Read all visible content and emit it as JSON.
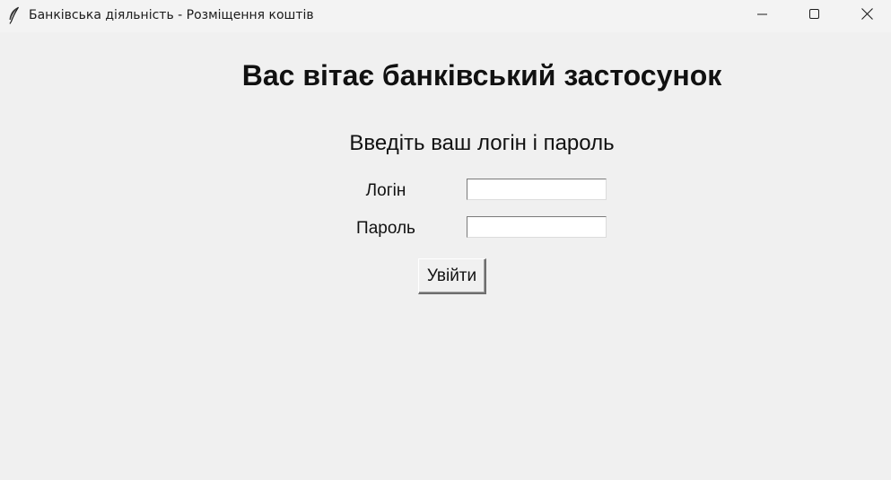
{
  "window": {
    "title": "Банківська діяльність - Розміщення коштів",
    "icon": "feather-icon",
    "controls": {
      "minimize_icon": "minimize-icon",
      "maximize_icon": "maximize-icon",
      "close_icon": "close-icon"
    }
  },
  "main": {
    "heading": "Вас вітає банківський застосунок",
    "subheading": "Введіть ваш логін і пароль",
    "login": {
      "label": "Логін",
      "value": ""
    },
    "password": {
      "label": "Пароль",
      "value": ""
    },
    "submit_label": "Увійти"
  }
}
